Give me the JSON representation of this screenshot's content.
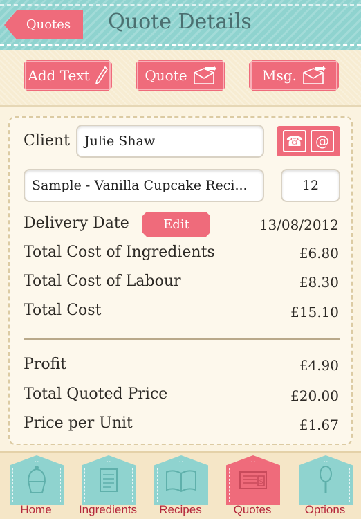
{
  "header": {
    "back_label": "Quotes",
    "title": "Quote Details"
  },
  "actions": {
    "add_text": "Add Text",
    "quote": "Quote",
    "msg": "Msg."
  },
  "form": {
    "client_label": "Client",
    "client_value": "Julie Shaw",
    "recipe_value": "Sample - Vanilla Cupcake Reci...",
    "quantity_value": "12",
    "contact_icons": [
      "phone-icon",
      "email-icon"
    ]
  },
  "summary": {
    "delivery_label": "Delivery Date",
    "edit_label": "Edit",
    "delivery_value": "13/08/2012",
    "ingredients_label": "Total Cost of Ingredients",
    "ingredients_value": "£6.80",
    "labour_label": "Total Cost of Labour",
    "labour_value": "£8.30",
    "total_label": "Total Cost",
    "total_value": "£15.10",
    "profit_label": "Profit",
    "profit_value": "£4.90",
    "quoted_label": "Total Quoted Price",
    "quoted_value": "£20.00",
    "unit_label": "Price per Unit",
    "unit_value": "£1.67"
  },
  "tabs": [
    {
      "label": "Home",
      "icon": "cupcake-icon"
    },
    {
      "label": "Ingredients",
      "icon": "notepad-icon"
    },
    {
      "label": "Recipes",
      "icon": "book-icon"
    },
    {
      "label": "Quotes",
      "icon": "invoice-icon",
      "active": true
    },
    {
      "label": "Options",
      "icon": "whisk-icon"
    }
  ],
  "colors": {
    "accent": "#ef6b7b",
    "header": "#8fd3cf",
    "background": "#f7ecd2",
    "tab_label": "#b4273b"
  }
}
